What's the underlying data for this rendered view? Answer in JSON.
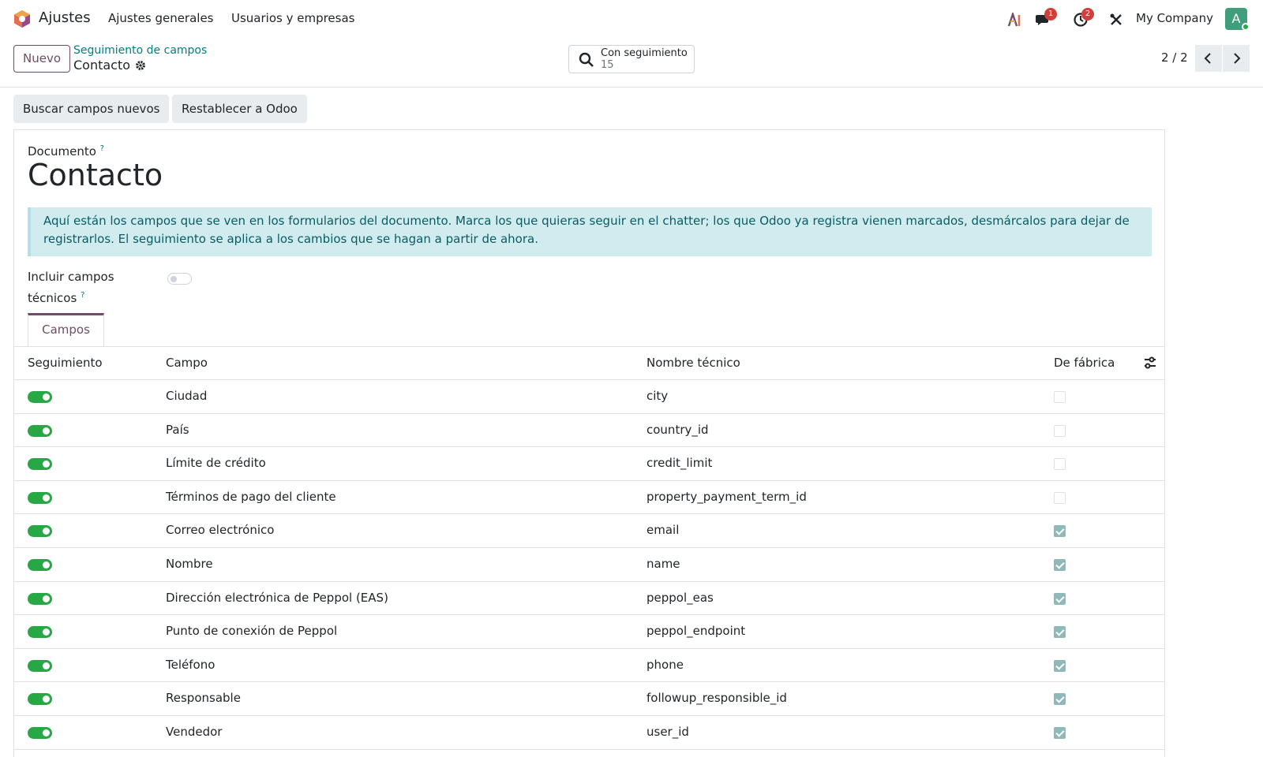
{
  "navbar": {
    "app_name": "Ajustes",
    "menus": [
      "Ajustes generales",
      "Usuarios y empresas"
    ],
    "messages_badge": "1",
    "activities_badge": "2",
    "company": "My Company",
    "avatar_letter": "A"
  },
  "control_panel": {
    "new_button": "Nuevo",
    "breadcrumb_parent": "Seguimiento de campos",
    "breadcrumb_current": "Contacto",
    "search_filter_label": "Con seguimiento",
    "search_filter_count": "15",
    "pager": "2 / 2"
  },
  "actions": {
    "find_new_fields": "Buscar campos nuevos",
    "reset_to_odoo": "Restablecer a Odoo"
  },
  "form": {
    "document_label": "Documento",
    "help_mark": "?",
    "document_title": "Contacto",
    "alert_text": "Aquí están los campos que se ven en los formularios del documento. Marca los que quieras seguir en el chatter; los que Odoo ya registra vienen marcados, desmárcalos para dejar de registrarlos. El seguimiento se aplica a los cambios que se hagan a partir de ahora.",
    "include_technical_label_1": "Incluir campos",
    "include_technical_label_2": "técnicos",
    "include_technical_value": false,
    "tab_fields": "Campos"
  },
  "table": {
    "columns": {
      "tracking": "Seguimiento",
      "field": "Campo",
      "technical_name": "Nombre técnico",
      "default": "De fábrica"
    },
    "rows": [
      {
        "tracking": true,
        "field": "Ciudad",
        "technical_name": "city",
        "default": false
      },
      {
        "tracking": true,
        "field": "País",
        "technical_name": "country_id",
        "default": false
      },
      {
        "tracking": true,
        "field": "Límite de crédito",
        "technical_name": "credit_limit",
        "default": false
      },
      {
        "tracking": true,
        "field": "Términos de pago del cliente",
        "technical_name": "property_payment_term_id",
        "default": false
      },
      {
        "tracking": true,
        "field": "Correo electrónico",
        "technical_name": "email",
        "default": true
      },
      {
        "tracking": true,
        "field": "Nombre",
        "technical_name": "name",
        "default": true
      },
      {
        "tracking": true,
        "field": "Dirección electrónica de Peppol (EAS)",
        "technical_name": "peppol_eas",
        "default": true
      },
      {
        "tracking": true,
        "field": "Punto de conexión de Peppol",
        "technical_name": "peppol_endpoint",
        "default": true
      },
      {
        "tracking": true,
        "field": "Teléfono",
        "technical_name": "phone",
        "default": true
      },
      {
        "tracking": true,
        "field": "Responsable",
        "technical_name": "followup_responsible_id",
        "default": true
      },
      {
        "tracking": true,
        "field": "Vendedor",
        "technical_name": "user_id",
        "default": true
      }
    ]
  },
  "colors": {
    "brand": "#714b67",
    "link": "#017e84",
    "toggle_on": "#28a745",
    "alert_bg": "#d0ecef",
    "badge": "#d23f3a"
  }
}
